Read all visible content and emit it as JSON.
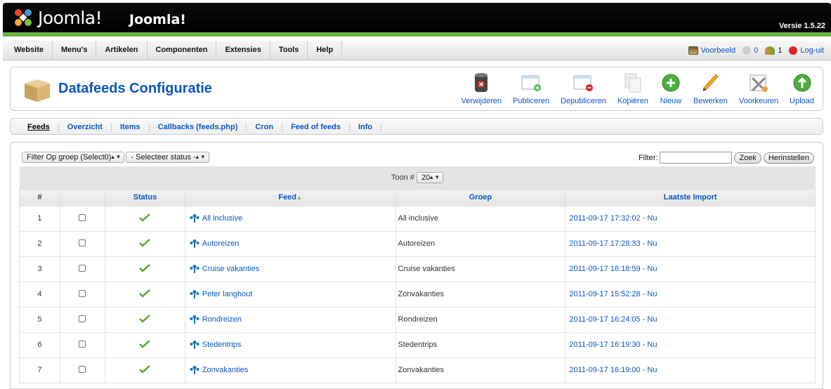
{
  "header": {
    "logo_text": "Joomla!",
    "site_name": "Joomla!",
    "version": "Versie 1.5.22"
  },
  "menu": [
    "Website",
    "Menu's",
    "Artikelen",
    "Componenten",
    "Extensies",
    "Tools",
    "Help"
  ],
  "status": {
    "preview": "Voorbeeld",
    "messages_count": "0",
    "users_count": "1",
    "logout": "Log-uit"
  },
  "page": {
    "title": "Datafeeds Configuratie"
  },
  "toolbar": [
    {
      "label": "Verwijderen",
      "icon": "trash-icon"
    },
    {
      "label": "Publiceren",
      "icon": "publish-icon"
    },
    {
      "label": "Depubliceren",
      "icon": "unpublish-icon"
    },
    {
      "label": "Kopiëren",
      "icon": "copy-icon"
    },
    {
      "label": "Nieuw",
      "icon": "new-icon"
    },
    {
      "label": "Bewerken",
      "icon": "edit-icon"
    },
    {
      "label": "Voorkeuren",
      "icon": "preferences-icon"
    },
    {
      "label": "Upload",
      "icon": "upload-icon"
    }
  ],
  "submenu": [
    "Feeds",
    "Overzicht",
    "Items",
    "Callbacks (feeds.php)",
    "Cron",
    "Feed of feeds",
    "Info"
  ],
  "filters": {
    "group_select": "Filter Op groep (Select0)",
    "status_select": "- Selecteer status -",
    "filter_label": "Filter:",
    "filter_value": "",
    "search_button": "Zoek",
    "reset_button": "Herinstellen"
  },
  "pager": {
    "label": "Toon #",
    "value": "20"
  },
  "table": {
    "columns": [
      "#",
      "",
      "Status",
      "Feed",
      "Groep",
      "Laatste Import"
    ],
    "rows": [
      {
        "num": "1",
        "feed": "All inclusive",
        "group": "All inclusive",
        "import": "2011-09-17 17:32:02 - Nu"
      },
      {
        "num": "2",
        "feed": "Autoreizen",
        "group": "Autoreizen",
        "import": "2011-09-17 17:28:33 - Nu"
      },
      {
        "num": "3",
        "feed": "Cruise vakanties",
        "group": "Cruise vakanties",
        "import": "2011-09-17 16:18:59 - Nu"
      },
      {
        "num": "4",
        "feed": "Peter langhout",
        "group": "Zonvakanties",
        "import": "2011-09-17 15:52:28 - Nu"
      },
      {
        "num": "5",
        "feed": "Rondreizen",
        "group": "Rondreizen",
        "import": "2011-09-17 16:24:05 - Nu"
      },
      {
        "num": "6",
        "feed": "Stedentrips",
        "group": "Stedentrips",
        "import": "2011-09-17 16:19:30 - Nu"
      },
      {
        "num": "7",
        "feed": "Zonvakanties",
        "group": "Zonvakanties",
        "import": "2011-09-17 16:19:00 - Nu"
      }
    ]
  }
}
